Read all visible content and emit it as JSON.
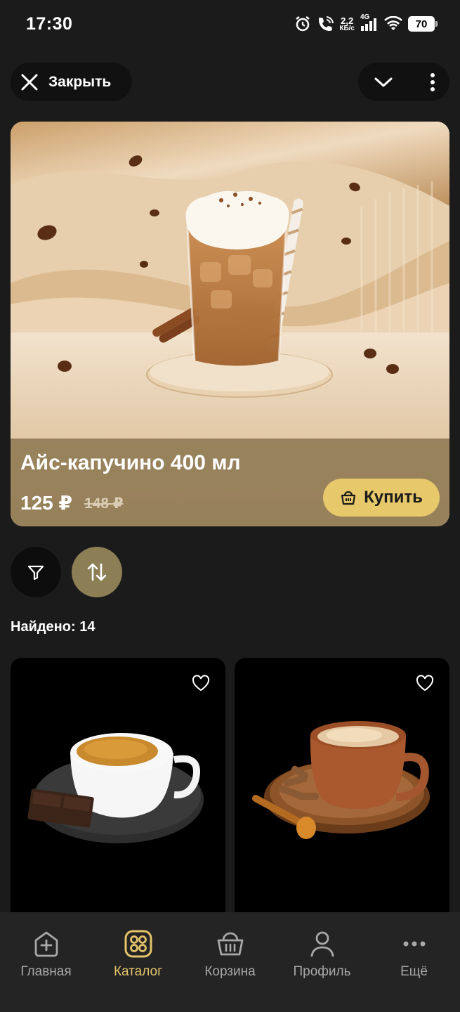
{
  "status_bar": {
    "time": "17:30",
    "net_speed_value": "2,2",
    "net_speed_unit": "КБ/с",
    "network": "4G",
    "battery": "70"
  },
  "top_bar": {
    "close_label": "Закрыть"
  },
  "hero": {
    "title": "Айс-капучино 400 мл",
    "price": "125 ₽",
    "old_price": "148 ₽",
    "buy_label": "Купить"
  },
  "filters": {
    "found_label": "Найдено: 14"
  },
  "products": [
    {
      "icon": "heart-icon"
    },
    {
      "icon": "heart-icon"
    }
  ],
  "nav": {
    "items": [
      {
        "label": "Главная",
        "icon": "home-plus-icon"
      },
      {
        "label": "Каталог",
        "icon": "catalog-grid-icon"
      },
      {
        "label": "Корзина",
        "icon": "basket-icon"
      },
      {
        "label": "Профиль",
        "icon": "profile-icon"
      },
      {
        "label": "Ещё",
        "icon": "more-dots-icon"
      }
    ]
  },
  "colors": {
    "background": "#1b1b1b",
    "accent": "#e3c36a",
    "buy_button": "#e7c86a",
    "sort_button": "#8c7f55"
  }
}
